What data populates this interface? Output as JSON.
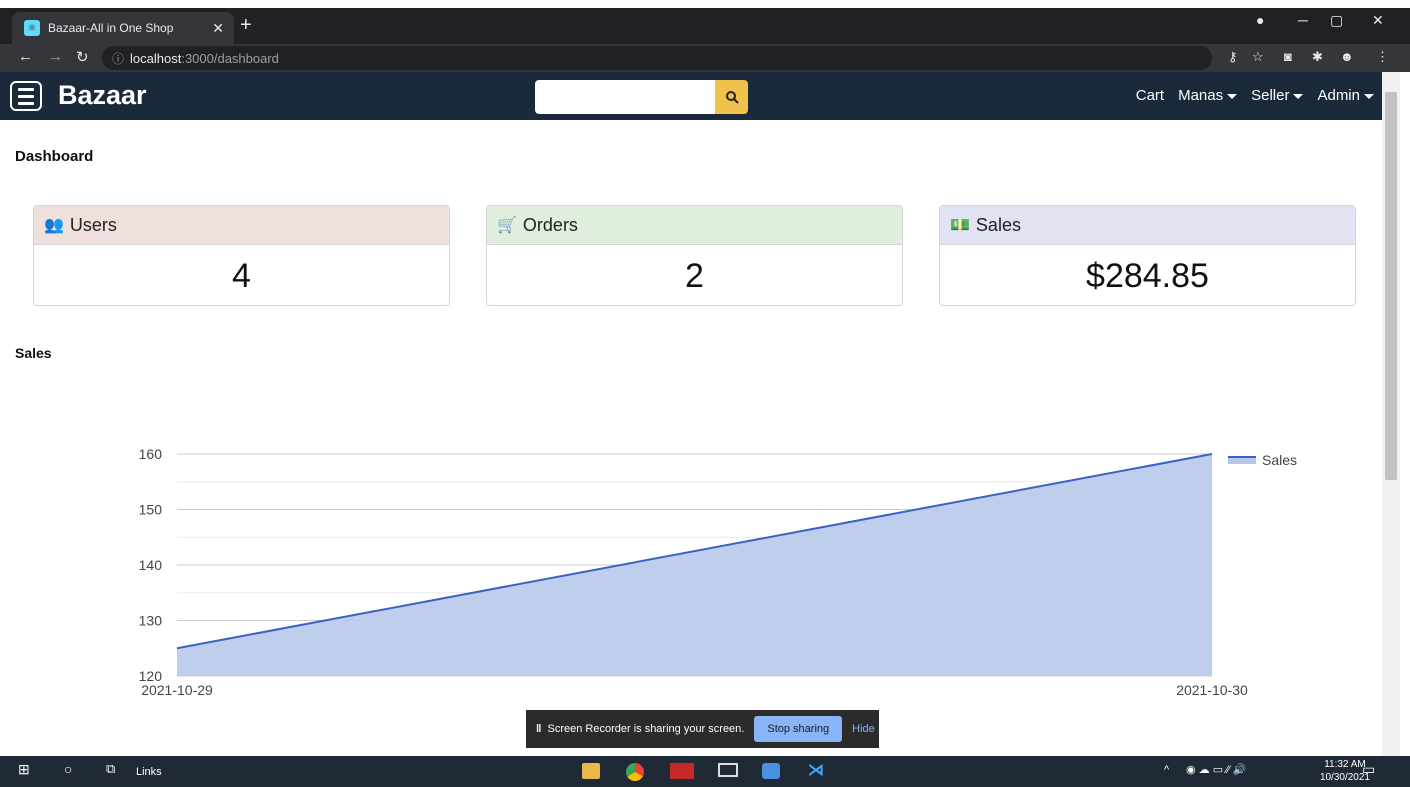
{
  "browser": {
    "tab_title": "Bazaar-All in One Shop",
    "url_host": "localhost",
    "url_path": ":3000/dashboard"
  },
  "navbar": {
    "brand": "Bazaar",
    "search_placeholder": "",
    "links": [
      "Cart",
      "Manas",
      "Seller",
      "Admin"
    ]
  },
  "page": {
    "title": "Dashboard",
    "cards": [
      {
        "label": "Users",
        "value": "4",
        "color": "#f0e0dd",
        "icon": "users-icon"
      },
      {
        "label": "Orders",
        "value": "2",
        "color": "#dfeedd",
        "icon": "shopping-cart-icon"
      },
      {
        "label": "Sales",
        "value": "$284.85",
        "color": "#e0e3f2",
        "icon": "money-bill-icon"
      }
    ],
    "chart_section_title": "Sales"
  },
  "chart_data": {
    "type": "area",
    "x": [
      "2021-10-29",
      "2021-10-30"
    ],
    "series": [
      {
        "name": "Sales",
        "values": [
          125,
          160
        ]
      }
    ],
    "y_ticks": [
      120,
      130,
      140,
      150,
      160
    ],
    "ylim": [
      120,
      160
    ],
    "grid": true,
    "legend": "right",
    "colors": {
      "line": "#3a62c4",
      "fill": "#b7c9ea"
    }
  },
  "share_bar": {
    "text": "Screen Recorder is sharing your screen.",
    "stop": "Stop sharing",
    "hide": "Hide"
  },
  "taskbar": {
    "links": "Links",
    "time": "11:32 AM",
    "date": "10/30/2021"
  }
}
